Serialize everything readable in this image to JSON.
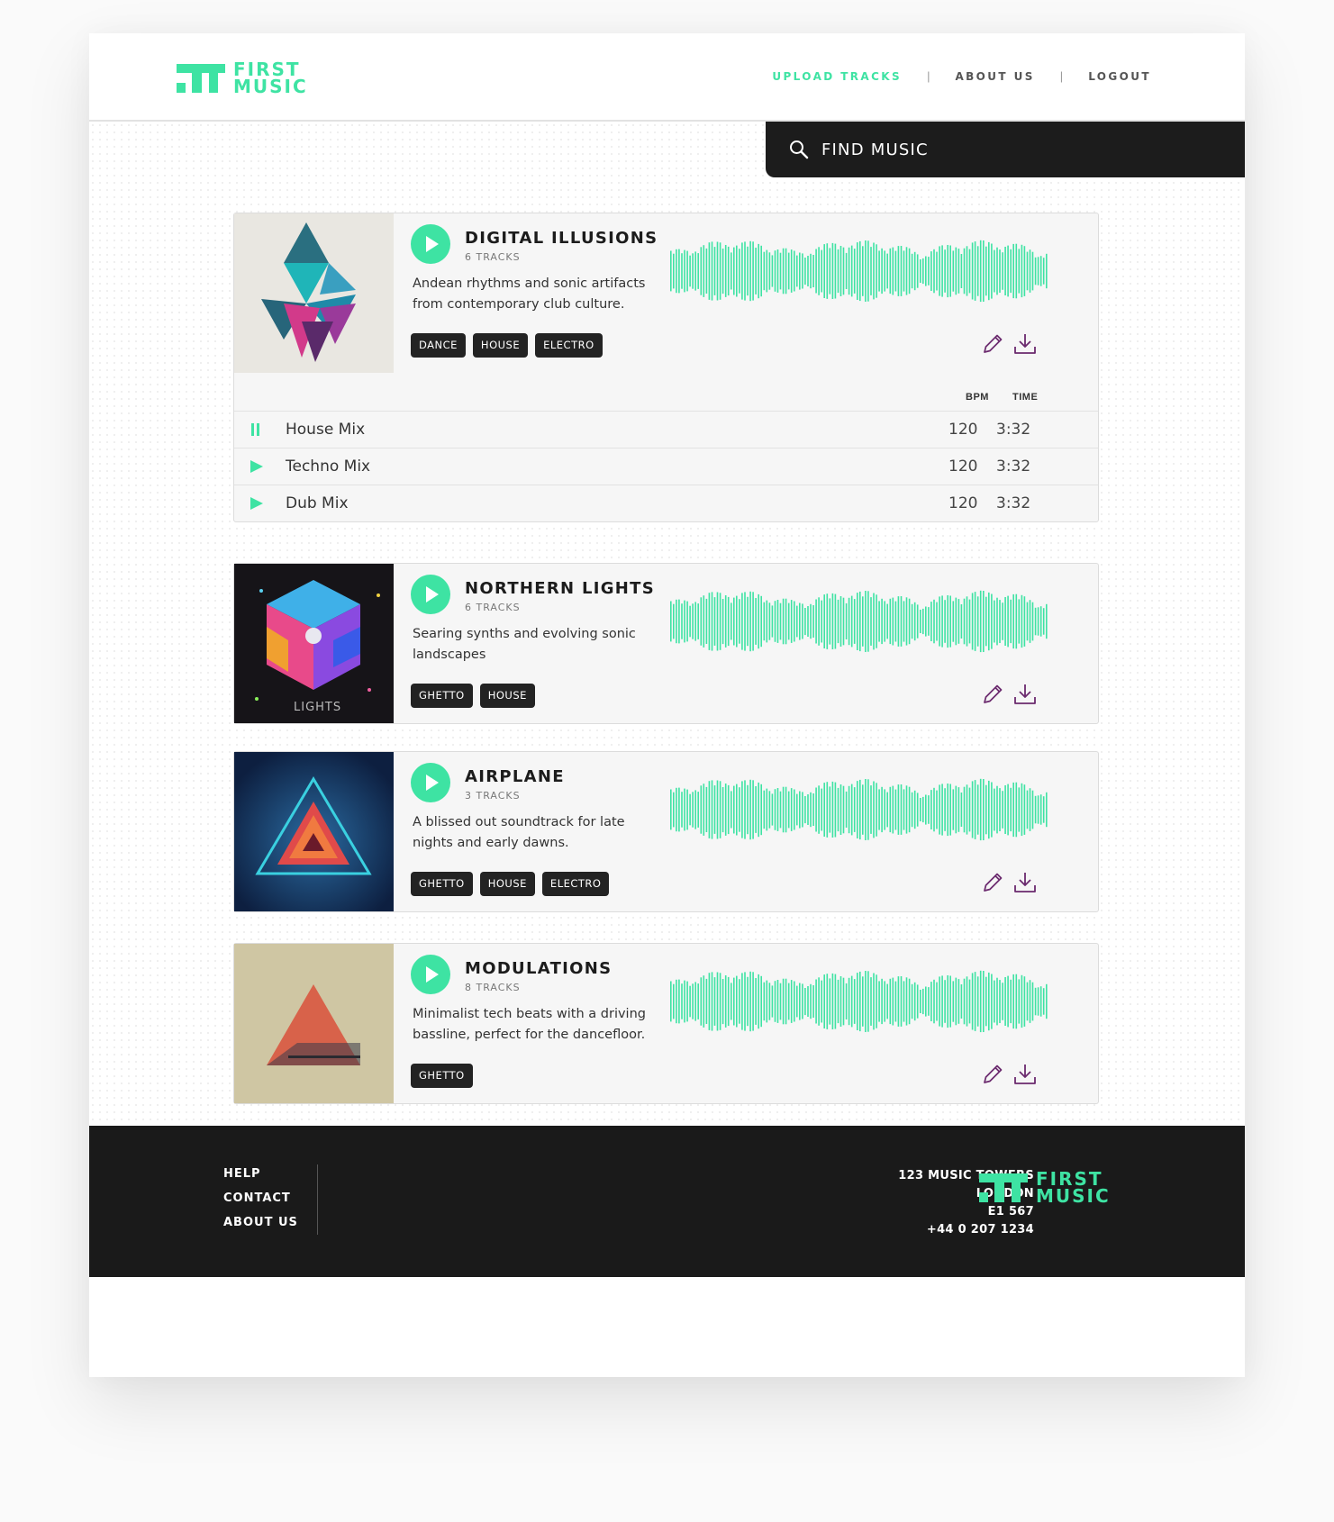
{
  "brand": {
    "name_line1": "FIRST",
    "name_line2": "MUSIC",
    "accent_color": "#3ee3a3",
    "dark_color": "#1c1c1c",
    "icon_color": "#6b2a6e"
  },
  "nav": {
    "items": [
      {
        "label": "UPLOAD TRACKS",
        "active": true
      },
      {
        "label": "ABOUT US",
        "active": false
      },
      {
        "label": "LOGOUT",
        "active": false
      }
    ],
    "separator": "|"
  },
  "search": {
    "label": "FIND MUSIC",
    "icon": "search-icon"
  },
  "albums": [
    {
      "title": "DIGITAL ILLUSIONS",
      "track_count": "6 TRACKS",
      "description": "Andean rhythms and sonic artifacts from contemporary club culture.",
      "tags": [
        "DANCE",
        "HOUSE",
        "ELECTRO"
      ],
      "expanded": true,
      "columns": {
        "bpm": "BPM",
        "time": "TIME"
      },
      "tracks": [
        {
          "name": "House Mix",
          "bpm": "120",
          "time": "3:32",
          "state": "playing"
        },
        {
          "name": "Techno Mix",
          "bpm": "120",
          "time": "3:32",
          "state": "stopped"
        },
        {
          "name": "Dub Mix",
          "bpm": "120",
          "time": "3:32",
          "state": "stopped"
        }
      ]
    },
    {
      "title": "NORTHERN LIGHTS",
      "track_count": "6 TRACKS",
      "description": "Searing synths and evolving sonic landscapes",
      "tags": [
        "GHETTO",
        "HOUSE"
      ],
      "cover_text": "LIGHTS"
    },
    {
      "title": "AIRPLANE",
      "track_count": "3 TRACKS",
      "description": "A blissed out soundtrack for late nights and early dawns.",
      "tags": [
        "GHETTO",
        "HOUSE",
        "ELECTRO"
      ]
    },
    {
      "title": "MODULATIONS",
      "track_count": "8 TRACKS",
      "description": "Minimalist tech beats with a driving bassline, perfect for the dancefloor.",
      "tags": [
        "GHETTO"
      ]
    }
  ],
  "footer": {
    "links": [
      "HELP",
      "CONTACT",
      "ABOUT US"
    ],
    "address": [
      "123  MUSIC TOWERS",
      "LONDON",
      "E1 567",
      "+44 0 207 1234"
    ]
  }
}
